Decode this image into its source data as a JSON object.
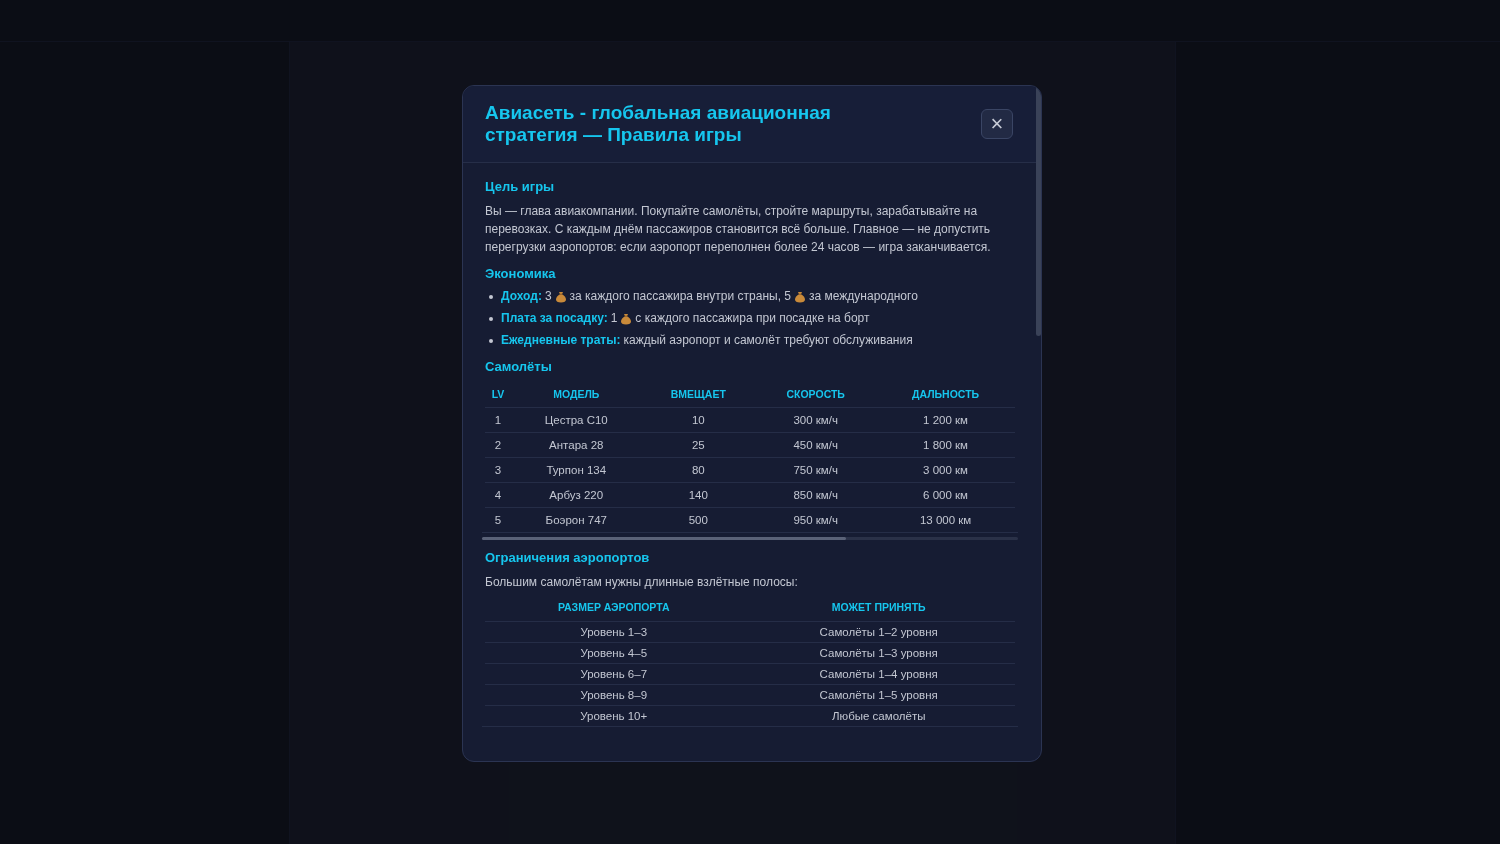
{
  "modal": {
    "title": "Авиасеть - глобальная авиационная стратегия — Правила игры",
    "close": "×",
    "sections": [
      {
        "kind": "text",
        "heading": "Цель игры",
        "text": "Вы — глава авиакомпании. Покупайте самолёты, стройте маршруты, зарабатывайте на перевозках. С каждым днём пассажиров становится всё больше. Главное — не допустить перегрузки аэропортов: если аэропорт переполнен более 24 часов — игра заканчивается."
      },
      {
        "kind": "bullets",
        "heading": "Экономика",
        "items": [
          {
            "label": "Доход:",
            "segments": [
              "3",
              "за каждого пассажира внутри страны, 5",
              "за международного"
            ]
          },
          {
            "label": "Плата за посадку:",
            "segments": [
              "1",
              "с каждого пассажира при посадке на борт"
            ]
          },
          {
            "label": "Ежедневные траты:",
            "segments": [
              "каждый аэропорт и самолёт требуют обслуживания"
            ]
          }
        ]
      },
      {
        "kind": "table",
        "heading": "Самолёты",
        "columns": [
          "LV",
          "МОДЕЛЬ",
          "ВМЕЩАЕТ",
          "СКОРОСТЬ",
          "ДАЛЬНОСТЬ"
        ],
        "scrollbar": true,
        "rows": [
          [
            "1",
            "Цестра С10",
            "10",
            "300 км/ч",
            "1 200 км"
          ],
          [
            "2",
            "Антара 28",
            "25",
            "450 км/ч",
            "1 800 км"
          ],
          [
            "3",
            "Турпон 134",
            "80",
            "750 км/ч",
            "3 000 км"
          ],
          [
            "4",
            "Арбуз 220",
            "140",
            "850 км/ч",
            "6 000 км"
          ],
          [
            "5",
            "Боэрон 747",
            "500",
            "950 км/ч",
            "13 000 км"
          ]
        ]
      },
      {
        "kind": "table",
        "heading": "Ограничения аэропортов",
        "intro": "Большим самолётам нужны длинные взлётные полосы:",
        "columns": [
          "РАЗМЕР АЭРОПОРТА",
          "МОЖЕТ ПРИНЯТЬ"
        ],
        "scrollbar": false,
        "rows": [
          [
            "Уровень 1–3",
            "Самолёты 1–2 уровня"
          ],
          [
            "Уровень 4–5",
            "Самолёты 1–3 уровня"
          ],
          [
            "Уровень 6–7",
            "Самолёты 1–4 уровня"
          ],
          [
            "Уровень 8–9",
            "Самолёты 1–5 уровня"
          ],
          [
            "Уровень 10+",
            "Любые самолёты"
          ]
        ]
      }
    ]
  }
}
